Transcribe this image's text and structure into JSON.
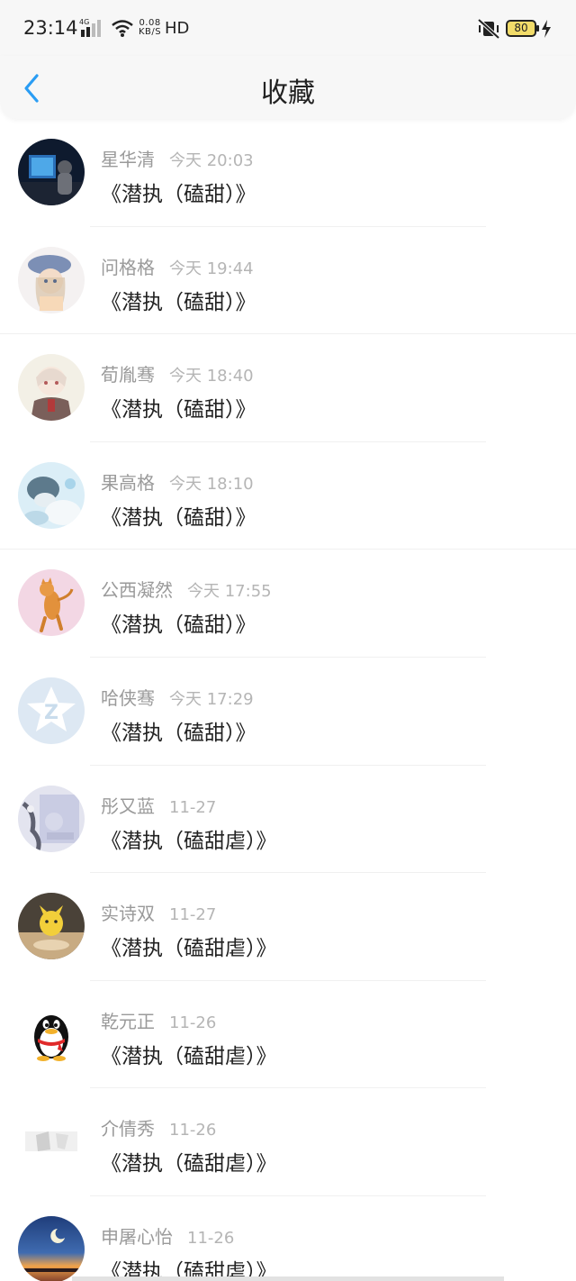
{
  "status": {
    "time": "23:14",
    "network": "4G",
    "speed_value": "0.08",
    "speed_unit": "KB/S",
    "hd": "HD",
    "battery": "80"
  },
  "nav": {
    "title": "收藏"
  },
  "items": [
    {
      "name": "星华清",
      "time": "今天 20:03",
      "title": "《潜执（磕甜）》"
    },
    {
      "name": "问格格",
      "time": "今天 19:44",
      "title": "《潜执（磕甜）》"
    },
    {
      "name": "荀胤骞",
      "time": "今天 18:40",
      "title": "《潜执（磕甜）》"
    },
    {
      "name": "果高格",
      "time": "今天 18:10",
      "title": "《潜执（磕甜）》"
    },
    {
      "name": "公西凝然",
      "time": "今天 17:55",
      "title": "《潜执（磕甜）》"
    },
    {
      "name": "哈侠骞",
      "time": "今天 17:29",
      "title": "《潜执（磕甜）》"
    },
    {
      "name": "彤又蓝",
      "time": "11-27",
      "title": "《潜执（磕甜虐）》"
    },
    {
      "name": "实诗双",
      "time": "11-27",
      "title": "《潜执（磕甜虐）》"
    },
    {
      "name": "乾元正",
      "time": "11-26",
      "title": "《潜执（磕甜虐）》"
    },
    {
      "name": "介倩秀",
      "time": "11-26",
      "title": "《潜执（磕甜虐）》"
    },
    {
      "name": "申屠心怡",
      "time": "11-26",
      "title": "《潜执（磕甜虐）》"
    }
  ],
  "colors": {
    "accent": "#2a9df4",
    "name_text": "#9a9a9a",
    "time_text": "#b5b5b5",
    "title_text": "#222222",
    "header_bg": "#f7f7f7"
  }
}
